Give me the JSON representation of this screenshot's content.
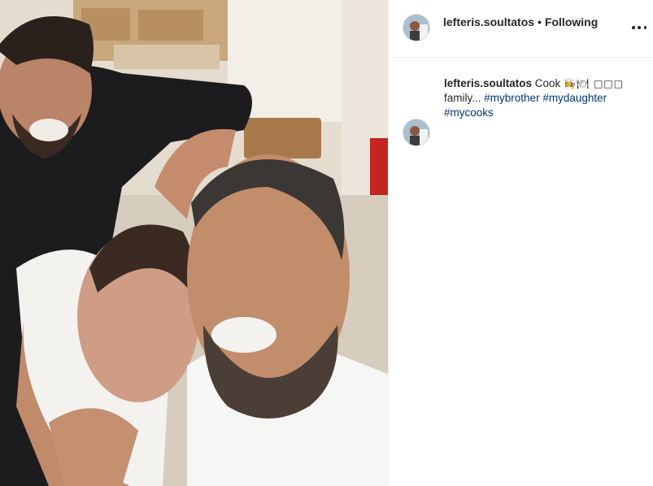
{
  "post": {
    "username": "lefteris.soultatos",
    "separator": "•",
    "follow_status": "Following",
    "more_icon": "more-horizontal-icon",
    "caption": {
      "username": "lefteris.soultatos",
      "text_before": "Cook",
      "emojis": "👩‍🍳🍽 □□□",
      "text_after": "family...",
      "hashtags": [
        "#mybrother",
        "#mydaughter",
        "#mycooks"
      ]
    }
  },
  "colors": {
    "hashtag": "#00376b",
    "text": "#262626",
    "divider": "#efefef"
  }
}
